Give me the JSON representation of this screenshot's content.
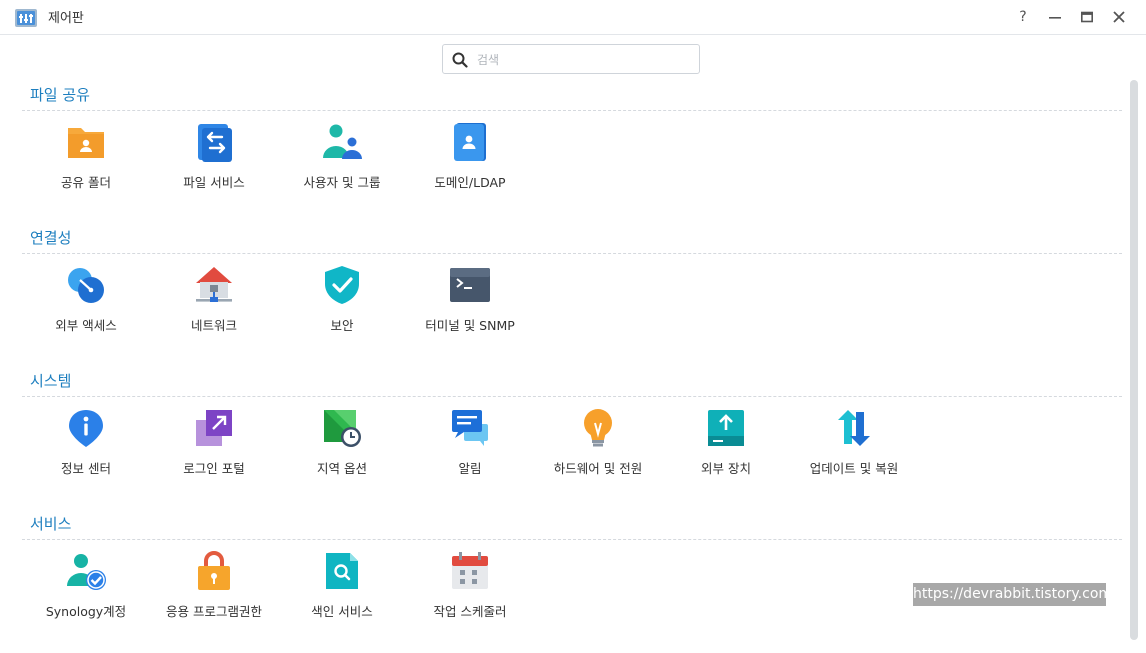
{
  "window": {
    "title": "제어판",
    "help_label": "?",
    "minimize_label": "—",
    "maximize_label": "□",
    "close_label": "✕"
  },
  "search": {
    "placeholder": "검색",
    "value": ""
  },
  "sections": [
    {
      "title": "파일 공유",
      "items": [
        {
          "label": "공유 폴더",
          "icon": "shared-folder-icon"
        },
        {
          "label": "파일 서비스",
          "icon": "file-services-icon"
        },
        {
          "label": "사용자 및 그룹",
          "icon": "user-group-icon"
        },
        {
          "label": "도메인/LDAP",
          "icon": "domain-ldap-icon"
        }
      ]
    },
    {
      "title": "연결성",
      "items": [
        {
          "label": "외부 액세스",
          "icon": "external-access-icon"
        },
        {
          "label": "네트워크",
          "icon": "network-icon"
        },
        {
          "label": "보안",
          "icon": "security-shield-icon"
        },
        {
          "label": "터미널 및 SNMP",
          "icon": "terminal-icon"
        }
      ]
    },
    {
      "title": "시스템",
      "items": [
        {
          "label": "정보 센터",
          "icon": "info-center-icon"
        },
        {
          "label": "로그인 포털",
          "icon": "login-portal-icon"
        },
        {
          "label": "지역 옵션",
          "icon": "regional-options-icon"
        },
        {
          "label": "알림",
          "icon": "notification-icon"
        },
        {
          "label": "하드웨어 및 전원",
          "icon": "hardware-power-icon"
        },
        {
          "label": "외부 장치",
          "icon": "external-devices-icon"
        },
        {
          "label": "업데이트 및 복원",
          "icon": "update-restore-icon"
        }
      ]
    },
    {
      "title": "서비스",
      "items": [
        {
          "label": "Synology계정",
          "icon": "synology-account-icon"
        },
        {
          "label": "응용 프로그램권한",
          "icon": "application-privileges-icon"
        },
        {
          "label": "색인 서비스",
          "icon": "indexing-service-icon"
        },
        {
          "label": "작업 스케줄러",
          "icon": "task-scheduler-icon"
        }
      ]
    }
  ],
  "watermark": "https://devrabbit.tistory.com"
}
